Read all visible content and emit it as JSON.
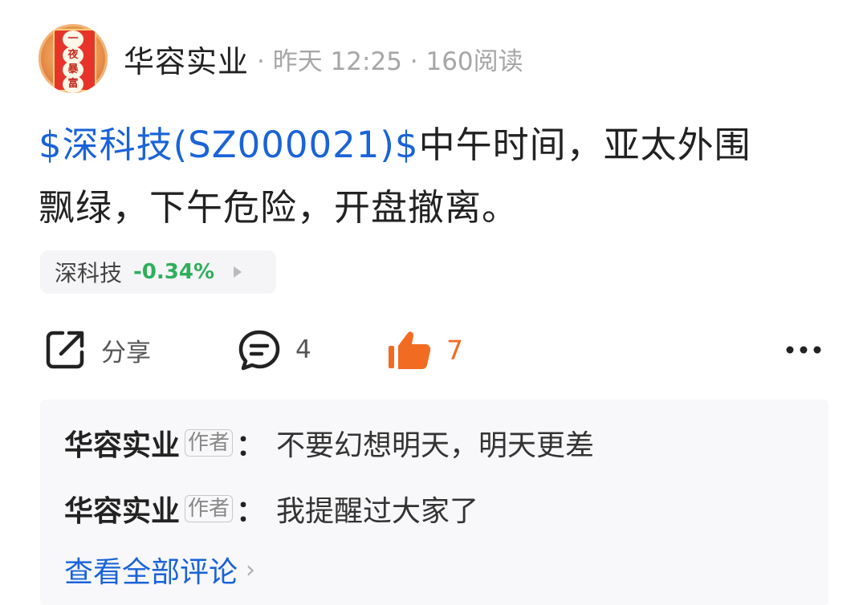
{
  "header": {
    "author": "华容实业",
    "meta": "· 昨天 12:25 · 160阅读",
    "avatar_chars": [
      "一",
      "夜",
      "暴",
      "富"
    ]
  },
  "post": {
    "stock_link": "$深科技(SZ000021)$",
    "text_line1": "中午时间，亚太外围",
    "text_line2": "飘绿，下午危险，开盘撤离。"
  },
  "stock_chip": {
    "name": "深科技",
    "change": "-0.34%",
    "change_color": "#2fae5c"
  },
  "actions": {
    "share_label": "分享",
    "comment_count": "4",
    "like_count": "7",
    "like_color": "#f16b22"
  },
  "comments": [
    {
      "author": "华容实业",
      "badge": "作者",
      "colon": "：",
      "text": "不要幻想明天，明天更差"
    },
    {
      "author": "华容实业",
      "badge": "作者",
      "colon": "：",
      "text": "我提醒过大家了"
    }
  ],
  "view_all_label": "查看全部评论",
  "colors": {
    "link": "#1a63d8",
    "text": "#222222",
    "meta": "#a6a6a6"
  }
}
